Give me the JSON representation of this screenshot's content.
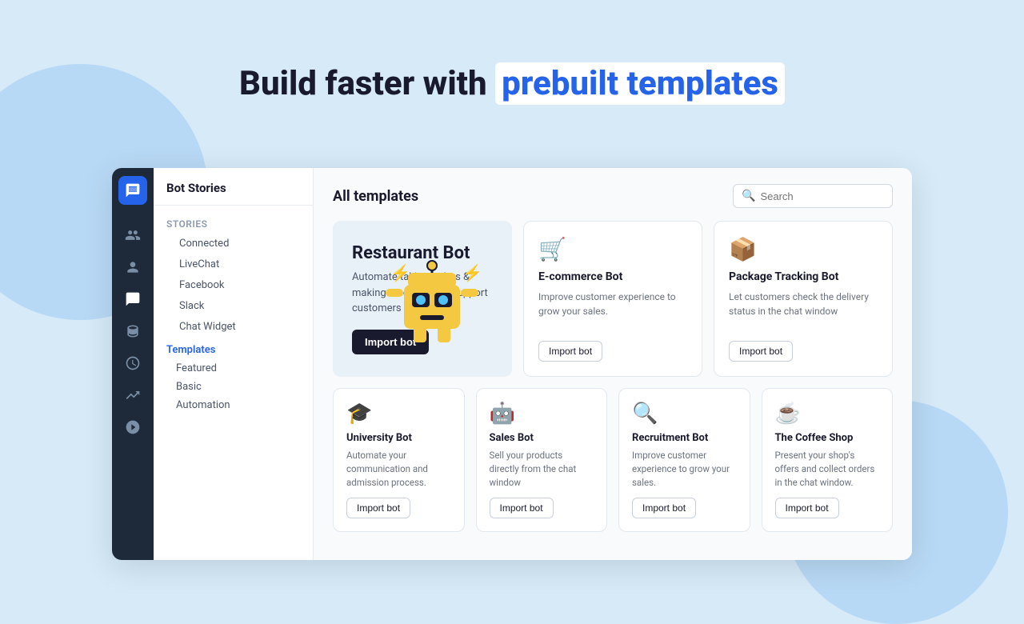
{
  "header": {
    "line1": "Build faster with ",
    "highlight": "prebuilt templates"
  },
  "app": {
    "title": "Bot Stories"
  },
  "sidebar": {
    "section1_label": "Stories",
    "items": [
      "Connected",
      "LiveChat",
      "Facebook",
      "Slack",
      "Chat Widget"
    ],
    "section2_label": "Templates",
    "sub_items": [
      "Featured",
      "Basic",
      "Automation"
    ]
  },
  "search": {
    "placeholder": "Search"
  },
  "main_title": "All templates",
  "templates": {
    "featured": {
      "title": "Restaurant Bot",
      "description": "Automate taking orders & making reservations. Support customers 24/7.",
      "button": "Import bot"
    },
    "cards": [
      {
        "icon": "🛒",
        "title": "E-commerce Bot",
        "description": "Improve customer experience to grow your sales.",
        "button": "Import bot"
      },
      {
        "icon": "📦",
        "title": "Package Tracking Bot",
        "description": "Let customers check the delivery status in the chat window",
        "button": "Import bot"
      }
    ],
    "small_cards": [
      {
        "icon": "🎓",
        "title": "University Bot",
        "description": "Automate your communication and admission process.",
        "button": "Import bot"
      },
      {
        "icon": "🤖",
        "title": "Sales Bot",
        "description": "Sell your products directly from the chat window",
        "button": "Import bot"
      },
      {
        "icon": "🔍",
        "title": "Recruitment Bot",
        "description": "Improve customer experience to grow your sales.",
        "button": "Import bot"
      },
      {
        "icon": "☕",
        "title": "The Coffee Shop",
        "description": "Present your shop's offers and collect orders in the chat window.",
        "button": "Import bot"
      }
    ]
  },
  "nav_icons": [
    "👥",
    "👤",
    "💬",
    "🗄",
    "⏱",
    "📈",
    "⚙️"
  ]
}
